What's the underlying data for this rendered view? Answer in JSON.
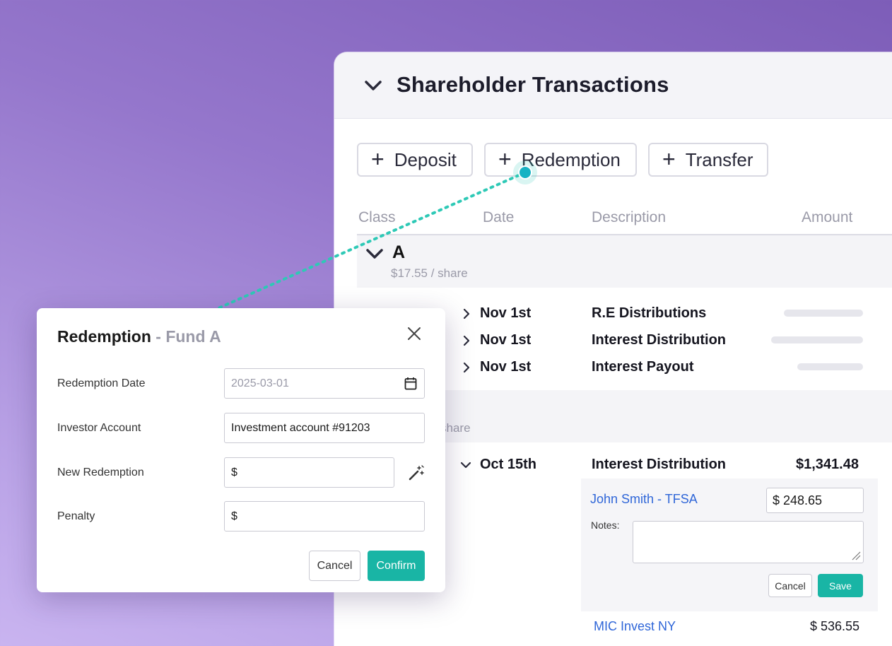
{
  "panel": {
    "title": "Shareholder Transactions",
    "actions": [
      {
        "label": "Deposit"
      },
      {
        "label": "Redemption"
      },
      {
        "label": "Transfer"
      }
    ],
    "columns": [
      "Class",
      "Date",
      "Description",
      "Amount"
    ],
    "class_a": {
      "name": "A",
      "price": "$17.55 / share",
      "transactions": [
        {
          "date": "Nov 1st",
          "description": "R.E Distributions"
        },
        {
          "date": "Nov 1st",
          "description": "Interest Distribution"
        },
        {
          "date": "Nov 1st",
          "description": "Interest Payout"
        }
      ]
    },
    "class_b": {
      "price_partial": "share",
      "transaction": {
        "date": "Oct 15th",
        "description": "Interest Distribution",
        "amount": "$1,341.48"
      },
      "allocations": [
        {
          "investor": "John Smith - TFSA",
          "amount_value": "$ 248.65",
          "notes_label": "Notes:",
          "notes_value": "",
          "cancel_label": "Cancel",
          "save_label": "Save"
        },
        {
          "investor": "MIC Invest NY",
          "amount": "$ 536.55"
        }
      ]
    }
  },
  "modal": {
    "title": "Redemption",
    "subtitle": "- Fund A",
    "fields": {
      "redemption_date": {
        "label": "Redemption Date",
        "value": "2025-03-01"
      },
      "investor_account": {
        "label": "Investor Account",
        "value": "Investment account #91203"
      },
      "new_redemption": {
        "label": "New Redemption",
        "value": "$"
      },
      "penalty": {
        "label": "Penalty",
        "value": "$"
      }
    },
    "cancel_label": "Cancel",
    "confirm_label": "Confirm"
  },
  "colors": {
    "accent": "#19b5a5",
    "link": "#2f66d8",
    "connector": "#2ec9b6",
    "background_top": "#7d5db8",
    "background_bottom": "#c9b4f0"
  },
  "icons": [
    "chevron-down-icon",
    "plus-icon",
    "chevron-right-icon",
    "close-icon",
    "calendar-icon",
    "magic-wand-icon",
    "resize-grip-icon"
  ]
}
